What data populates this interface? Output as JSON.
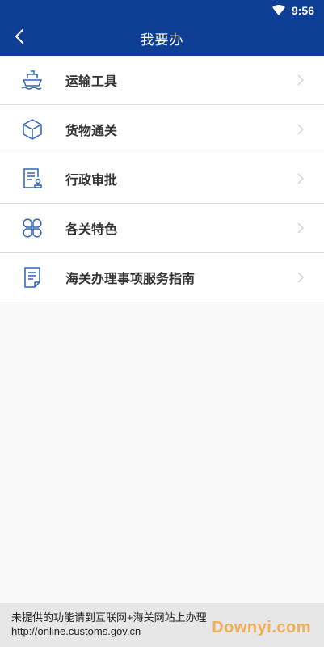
{
  "status": {
    "time": "9:56"
  },
  "header": {
    "title": "我要办"
  },
  "menu": [
    {
      "label": "运输工具",
      "icon": "ship-icon"
    },
    {
      "label": "货物通关",
      "icon": "box-icon"
    },
    {
      "label": "行政审批",
      "icon": "approval-document-icon"
    },
    {
      "label": "各关特色",
      "icon": "clover-icon"
    },
    {
      "label": "海关办理事项服务指南",
      "icon": "guide-document-icon"
    }
  ],
  "footer": {
    "notice": "未提供的功能请到互联网+海关网站上办理http://online.customs.gov.cn"
  },
  "watermark": "Downyi.com",
  "colors": {
    "brand": "#0e3f94",
    "icon": "#2f63b3"
  }
}
